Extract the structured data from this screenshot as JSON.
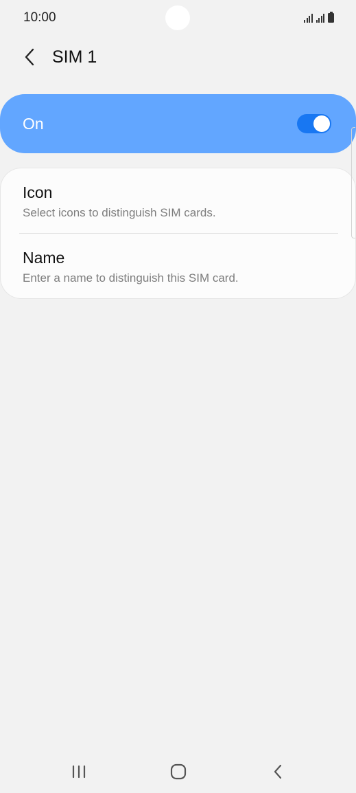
{
  "status_bar": {
    "time": "10:00"
  },
  "header": {
    "title": "SIM 1",
    "back_icon": "chevron-left-icon"
  },
  "master_switch": {
    "label": "On",
    "enabled": true,
    "accent_color": "#62a6ff",
    "toggle_color": "#1877f2"
  },
  "settings": {
    "items": [
      {
        "title": "Icon",
        "subtitle": "Select icons to distinguish SIM cards."
      },
      {
        "title": "Name",
        "subtitle": "Enter a name to distinguish this SIM card."
      }
    ]
  },
  "nav_bar": {
    "recents_icon": "recents-icon",
    "home_icon": "home-icon",
    "back_icon": "back-icon"
  }
}
